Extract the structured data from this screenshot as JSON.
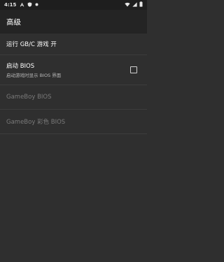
{
  "status_bar": {
    "time": "4:15",
    "left_icons": [
      "a-icon",
      "shield-icon",
      "notification-dot-icon"
    ],
    "right_icons": [
      "wifi-icon",
      "signal-icon",
      "battery-icon"
    ]
  },
  "app_bar": {
    "title": "高级"
  },
  "preferences": [
    {
      "title": "运行 GB/C 游戏 开",
      "summary": "",
      "enabled": true,
      "has_checkbox": false
    },
    {
      "title": "启动 BIOS",
      "summary": "启动游戏时显示 BIOS 界面",
      "enabled": true,
      "has_checkbox": true,
      "checked": false
    },
    {
      "title": "GameBoy BIOS",
      "summary": "",
      "enabled": false,
      "has_checkbox": false
    },
    {
      "title": "GameBoy 彩色 BIOS",
      "summary": "",
      "enabled": false,
      "has_checkbox": false
    }
  ]
}
